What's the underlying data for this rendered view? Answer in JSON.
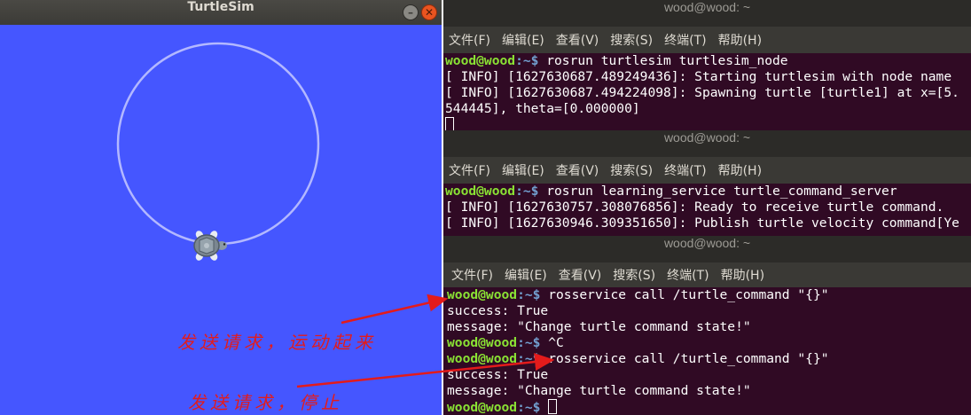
{
  "turtlesim": {
    "title": "TurtleSim",
    "background_color": "#4556ff",
    "trail_color": "#b3b8ff",
    "min_button": "minimize-icon",
    "close_button": "close-icon"
  },
  "terminals": [
    {
      "title": "wood@wood: ~",
      "menu": [
        "文件(F)",
        "编辑(E)",
        "查看(V)",
        "搜索(S)",
        "终端(T)",
        "帮助(H)"
      ],
      "lines": [
        {
          "prompt": "wood@wood",
          "path": ":~$",
          "text": " rosrun turtlesim turtlesim_node"
        },
        {
          "text": "[ INFO] [1627630687.489249436]: Starting turtlesim with node name "
        },
        {
          "text": "[ INFO] [1627630687.494224098]: Spawning turtle [turtle1] at x=[5."
        },
        {
          "text": "544445], theta=[0.000000]"
        }
      ]
    },
    {
      "title": "wood@wood: ~",
      "menu": [
        "文件(F)",
        "编辑(E)",
        "查看(V)",
        "搜索(S)",
        "终端(T)",
        "帮助(H)"
      ],
      "lines": [
        {
          "prompt": "wood@wood",
          "path": ":~$",
          "text": " rosrun learning_service turtle_command_server"
        },
        {
          "text": "[ INFO] [1627630757.308076856]: Ready to receive turtle command."
        },
        {
          "text": "[ INFO] [1627630946.309351650]: Publish turtle velocity command[Ye"
        }
      ]
    },
    {
      "title": "wood@wood: ~",
      "menu": [
        "文件(F)",
        "编辑(E)",
        "查看(V)",
        "搜索(S)",
        "终端(T)",
        "帮助(H)"
      ],
      "lines": [
        {
          "prompt": "wood@wood",
          "path": ":~$",
          "text": " rosservice call /turtle_command \"{}\""
        },
        {
          "text": "success: True"
        },
        {
          "text": "message: \"Change turtle command state!\""
        },
        {
          "prompt": "wood@wood",
          "path": ":~$",
          "text": " ^C"
        },
        {
          "prompt": "wood@wood",
          "path": ":~$",
          "text": " rosservice call /turtle_command \"{}\""
        },
        {
          "text": "success: True"
        },
        {
          "text": "message: \"Change turtle command state!\""
        },
        {
          "prompt": "wood@wood",
          "path": ":~$",
          "text": " "
        }
      ]
    }
  ],
  "annotations": {
    "first": "发送请求，运动起来",
    "second": "发送请求，停止",
    "arrow_color": "#e31b1b"
  }
}
